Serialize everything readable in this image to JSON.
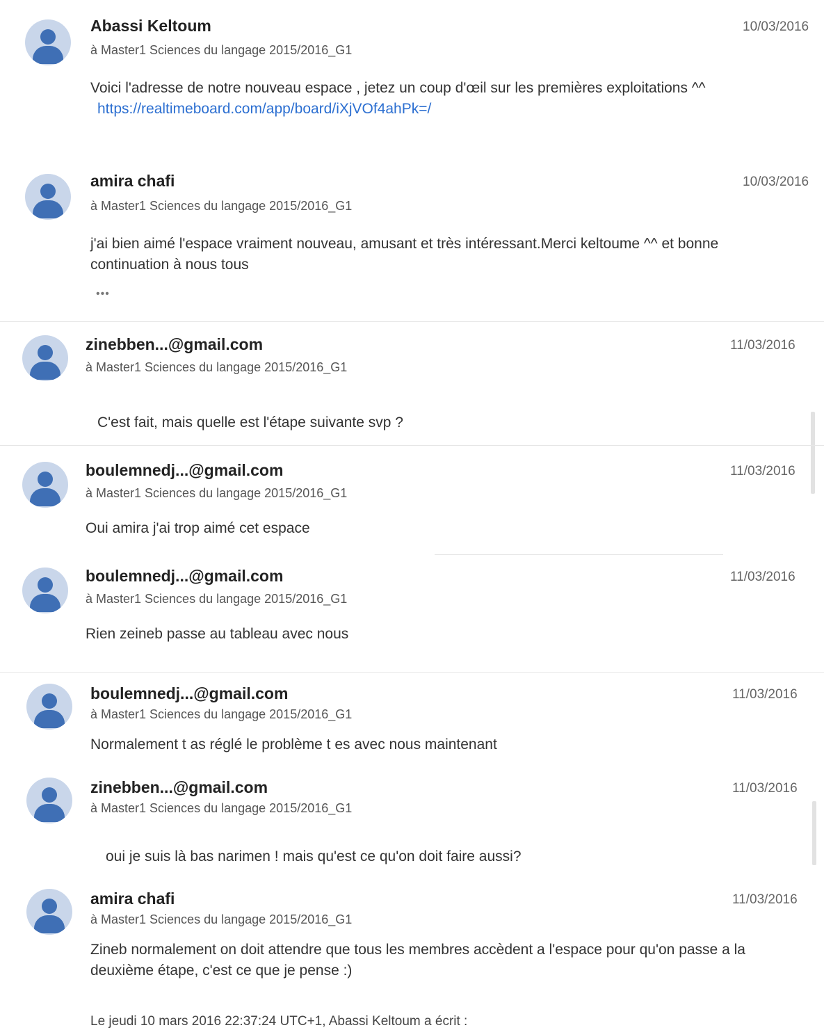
{
  "group_label": "à Master1 Sciences du langage 2015/2016_G1",
  "posts": [
    {
      "author": "Abassi Keltoum",
      "date": "10/03/2016",
      "text": "Voici l'adresse de notre nouveau espace , jetez un coup d'œil sur les premières exploitations ^^",
      "link": "https://realtimeboard.com/app/board/iXjVOf4ahPk=/"
    },
    {
      "author": "amira chafi",
      "date": "10/03/2016",
      "text": "j'ai bien aimé l'espace vraiment nouveau, amusant et très intéressant.Merci keltoume ^^ et bonne continuation à nous tous",
      "more": "•••"
    },
    {
      "author": "zinebben...@gmail.com",
      "date": "11/03/2016",
      "text": "C'est fait, mais quelle est l'étape suivante svp ?"
    },
    {
      "author": "boulemnedj...@gmail.com",
      "date": "11/03/2016",
      "text": "Oui amira j'ai trop aimé cet espace"
    },
    {
      "author": "boulemnedj...@gmail.com",
      "date": "11/03/2016",
      "text": "Rien zeineb passe au tableau avec nous"
    },
    {
      "author": "boulemnedj...@gmail.com",
      "date": "11/03/2016",
      "text": "Normalement t as réglé le problème t es avec nous maintenant"
    },
    {
      "author": "zinebben...@gmail.com",
      "date": "11/03/2016",
      "text": "oui je suis là bas narimen ! mais qu'est ce qu'on doit faire aussi?"
    },
    {
      "author": "amira chafi",
      "date": "11/03/2016",
      "text": "Zineb normalement on doit attendre que tous les membres accèdent a l'espace pour qu'on passe a la deuxième étape, c'est ce que je pense :)"
    }
  ],
  "quote_line": "Le jeudi 10 mars 2016 22:37:24 UTC+1, Abassi Keltoum a écrit :"
}
